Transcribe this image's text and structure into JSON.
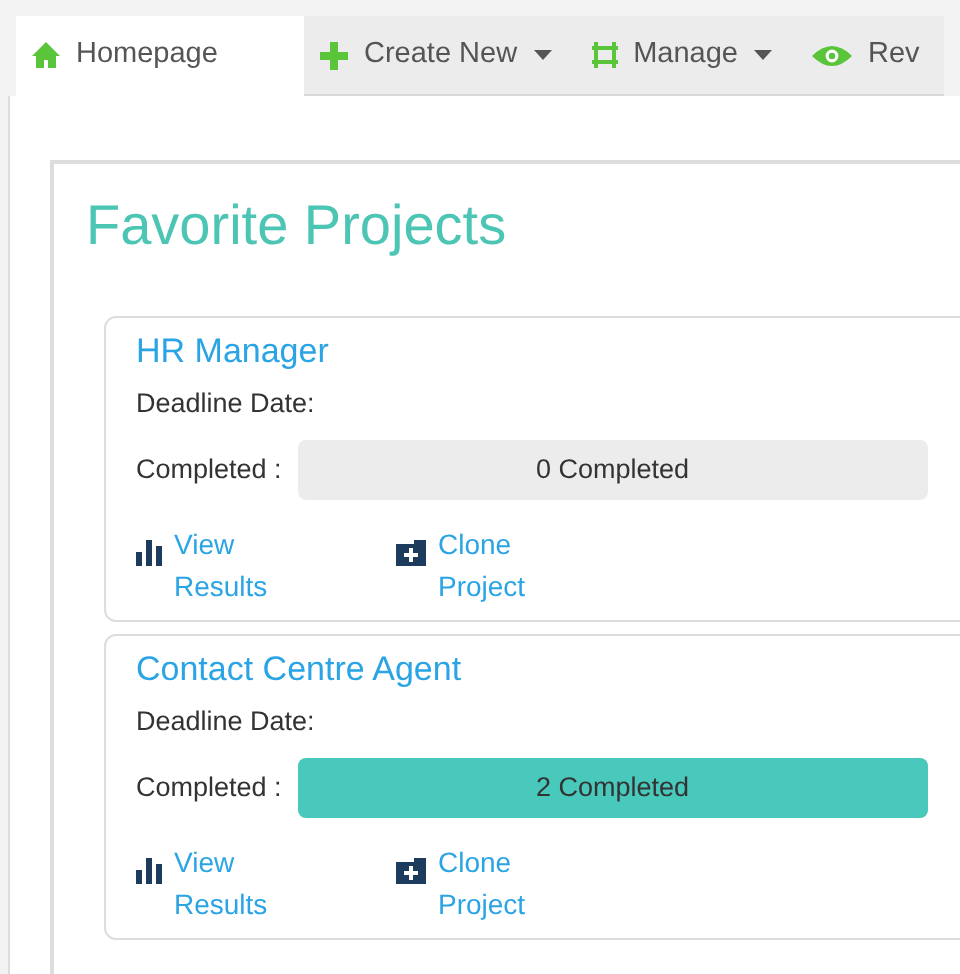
{
  "tabs": [
    {
      "label": "Homepage",
      "selected": true,
      "dropdown": false
    },
    {
      "label": "Create New",
      "selected": false,
      "dropdown": true
    },
    {
      "label": "Manage",
      "selected": false,
      "dropdown": true
    },
    {
      "label": "Rev",
      "selected": false,
      "dropdown": false
    }
  ],
  "heading": "Favorite Projects",
  "projects": [
    {
      "title": "HR Manager",
      "deadline_label": "Deadline Date:",
      "completed_label": "Completed :",
      "progress_text": "0 Completed",
      "level": 0,
      "actions": [
        {
          "kind": "results",
          "label": "View Results"
        },
        {
          "kind": "clone",
          "label": "Clone Project"
        }
      ]
    },
    {
      "title": "Contact Centre Agent",
      "deadline_label": "Deadline Date:",
      "completed_label": "Completed :",
      "progress_text": "2 Completed",
      "level": 1,
      "actions": [
        {
          "kind": "results",
          "label": "View Results"
        },
        {
          "kind": "clone",
          "label": "Clone Project"
        }
      ]
    }
  ]
}
